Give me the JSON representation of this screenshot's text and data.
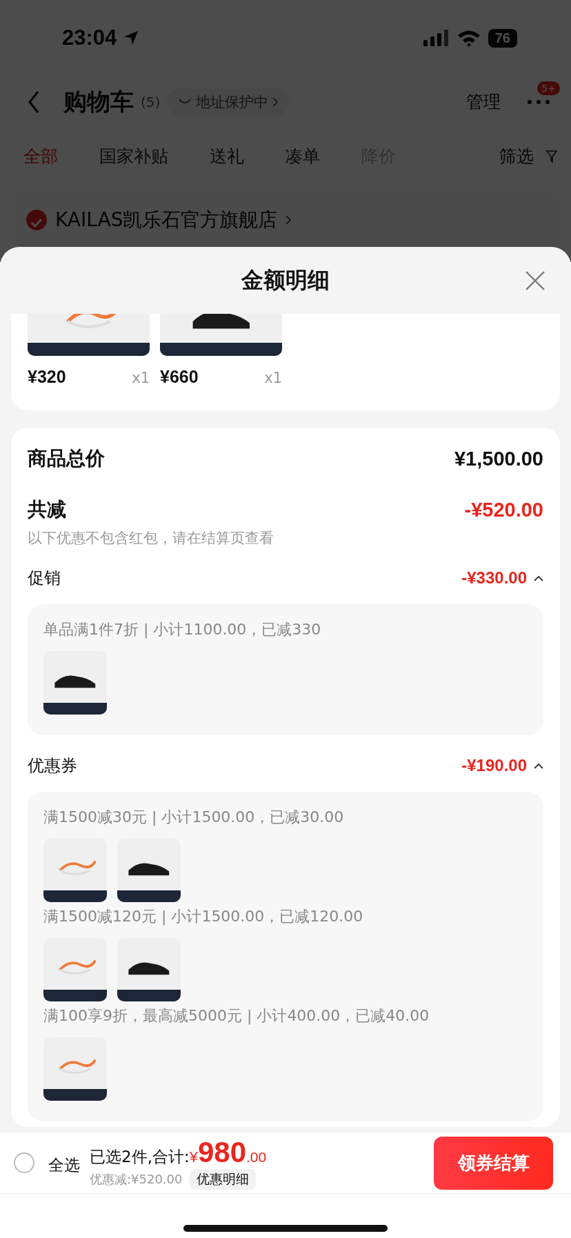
{
  "status_bar": {
    "time": "23:04",
    "battery": "76"
  },
  "nav": {
    "title": "购物车",
    "count": "(5)",
    "address_badge": "地址保护中",
    "manage": "管理",
    "more_badge": "5+"
  },
  "tabs": [
    {
      "label": "全部",
      "selected": true,
      "disabled": false
    },
    {
      "label": "国家补贴",
      "selected": false,
      "disabled": false
    },
    {
      "label": "送礼",
      "selected": false,
      "disabled": false
    },
    {
      "label": "凑单",
      "selected": false,
      "disabled": false
    },
    {
      "label": "降价",
      "selected": false,
      "disabled": true
    }
  ],
  "filter": "筛选",
  "store": {
    "name": "KAILAS凯乐石官方旗舰店",
    "checked": true
  },
  "sheet": {
    "title": "金额明细",
    "items": [
      {
        "kind": "rope",
        "price": "¥320",
        "qty": "x1"
      },
      {
        "kind": "shoe",
        "price": "¥660",
        "qty": "x1"
      }
    ],
    "total": {
      "label": "商品总价",
      "value": "¥1,500.00"
    },
    "discount": {
      "label": "共减",
      "value": "-¥520.00",
      "note": "以下优惠不包含红包，请在结算页查看"
    },
    "sections": [
      {
        "label": "促销",
        "value": "-¥330.00",
        "expanded": true,
        "rules": [
          {
            "text": "单品满1件7折 | 小计1100.00，已减330",
            "products": [
              {
                "kind": "shoe"
              }
            ]
          }
        ]
      },
      {
        "label": "优惠券",
        "value": "-¥190.00",
        "expanded": true,
        "rules": [
          {
            "text": "满1500减30元 | 小计1500.00，已减30.00",
            "products": [
              {
                "kind": "rope"
              },
              {
                "kind": "shoe"
              }
            ]
          },
          {
            "text": "满1500减120元 | 小计1500.00，已减120.00",
            "products": [
              {
                "kind": "rope"
              },
              {
                "kind": "shoe"
              }
            ]
          },
          {
            "text": "满100享9折，最高减5000元 | 小计400.00，已减40.00",
            "products": [
              {
                "kind": "rope"
              }
            ]
          }
        ]
      }
    ]
  },
  "bottom_bar": {
    "select_all": {
      "label": "全选",
      "checked": false
    },
    "summary": "已选2件,合计:",
    "currency": "¥",
    "amount": "980",
    "cents": ".00",
    "saved": "优惠减:¥520.00",
    "detail_button": "优惠明细",
    "checkout": "领券结算"
  }
}
